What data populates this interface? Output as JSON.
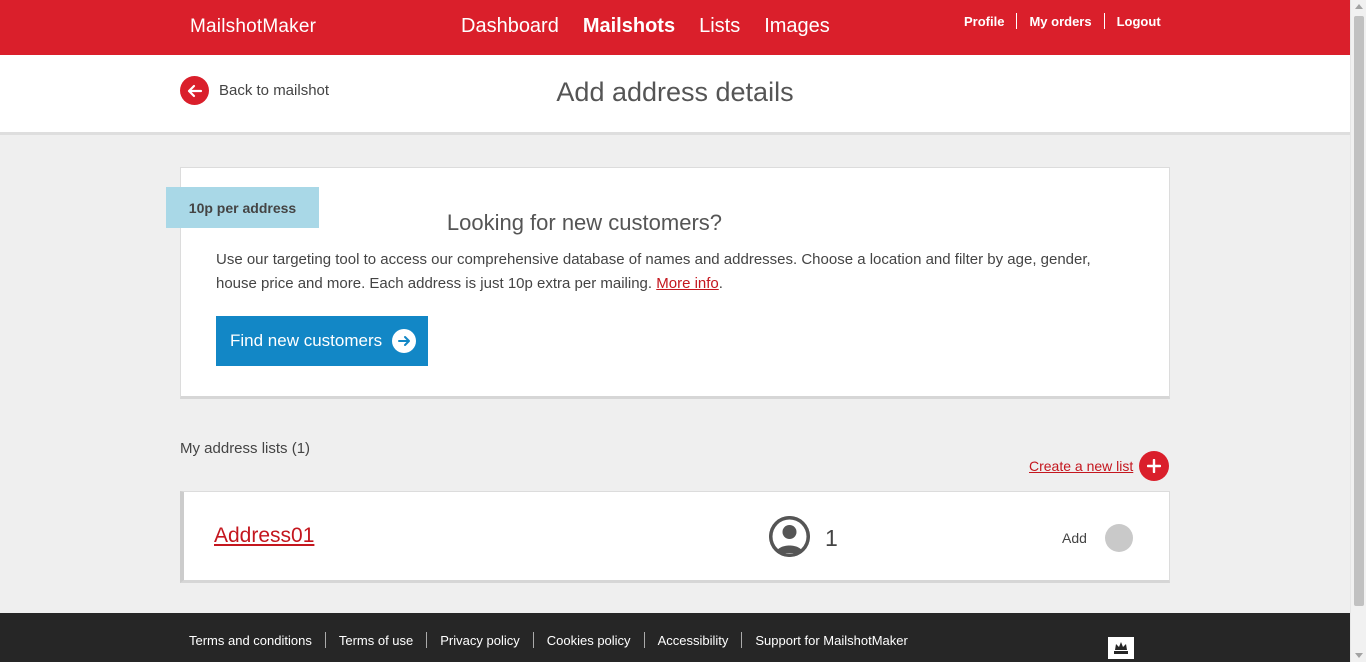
{
  "brand": {
    "name": "MailshotMaker"
  },
  "main_nav": [
    {
      "label": "Dashboard",
      "active": false
    },
    {
      "label": "Mailshots",
      "active": true
    },
    {
      "label": "Lists",
      "active": false
    },
    {
      "label": "Images",
      "active": false
    }
  ],
  "user_nav": {
    "profile": "Profile",
    "orders": "My orders",
    "logout": "Logout"
  },
  "header": {
    "back_label": "Back to mailshot",
    "title": "Add address details"
  },
  "promo": {
    "price_tag": "10p per address",
    "title": "Looking for new customers?",
    "text": "Use our targeting tool to access our comprehensive database of names and addresses. Choose a location and filter by age, gender, house price and more. Each address is just 10p extra per mailing.",
    "more_info": "More info",
    "text_end": ".",
    "button_label": "Find new customers"
  },
  "lists": {
    "heading": "My address lists (1)",
    "create_label": "Create a new list",
    "items": [
      {
        "name": "Address01",
        "count": "1",
        "add_label": "Add"
      }
    ]
  },
  "footer": {
    "links": [
      "Terms and conditions",
      "Terms of use",
      "Privacy policy",
      "Cookies policy",
      "Accessibility",
      "Support for MailshotMaker"
    ]
  },
  "colors": {
    "brand_red": "#da1f2b",
    "button_blue": "#1287c6",
    "price_tag_bg": "#a9d8e7",
    "footer_bg": "#262626"
  },
  "icons": {
    "back": "arrow-left-circle-icon",
    "find": "arrow-right-circle-icon",
    "create": "plus-circle-icon",
    "user": "user-avatar-icon",
    "crest": "royal-crest-icon"
  }
}
